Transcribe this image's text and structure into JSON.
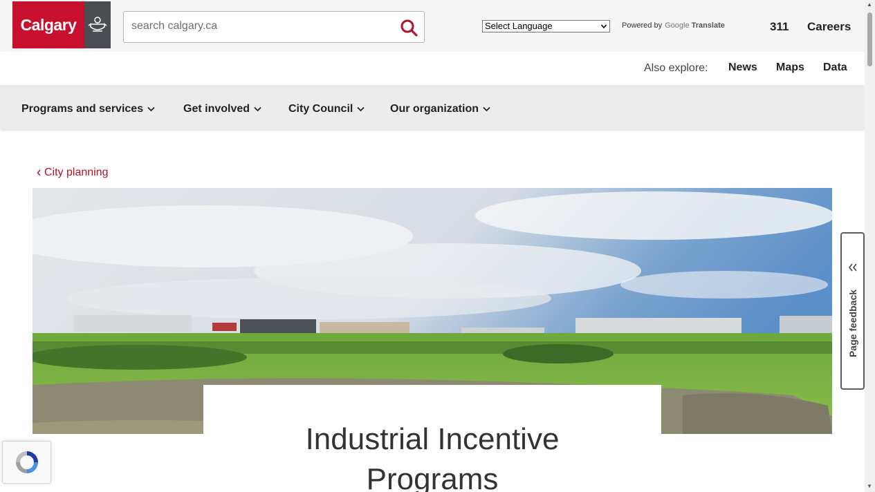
{
  "logo": {
    "text": "Calgary"
  },
  "search": {
    "placeholder": "search calgary.ca"
  },
  "language": {
    "selected": "Select Language"
  },
  "powered_by": {
    "prefix": "Powered by",
    "brand": "Google",
    "product": "Translate"
  },
  "top_links": [
    "311",
    "Careers"
  ],
  "explore": {
    "label": "Also explore:",
    "links": [
      "News",
      "Maps",
      "Data"
    ]
  },
  "nav": {
    "items": [
      "Programs and services",
      "Get involved",
      "City Council",
      "Our organization"
    ]
  },
  "breadcrumb": {
    "label": "City planning"
  },
  "page": {
    "title_line1": "Industrial Incentive",
    "title_line2": "Programs"
  },
  "feedback": {
    "label": "Page feedback"
  },
  "colors": {
    "brand_red": "#c8102e",
    "link_red": "#b3122a",
    "nav_bg": "#ececec"
  }
}
